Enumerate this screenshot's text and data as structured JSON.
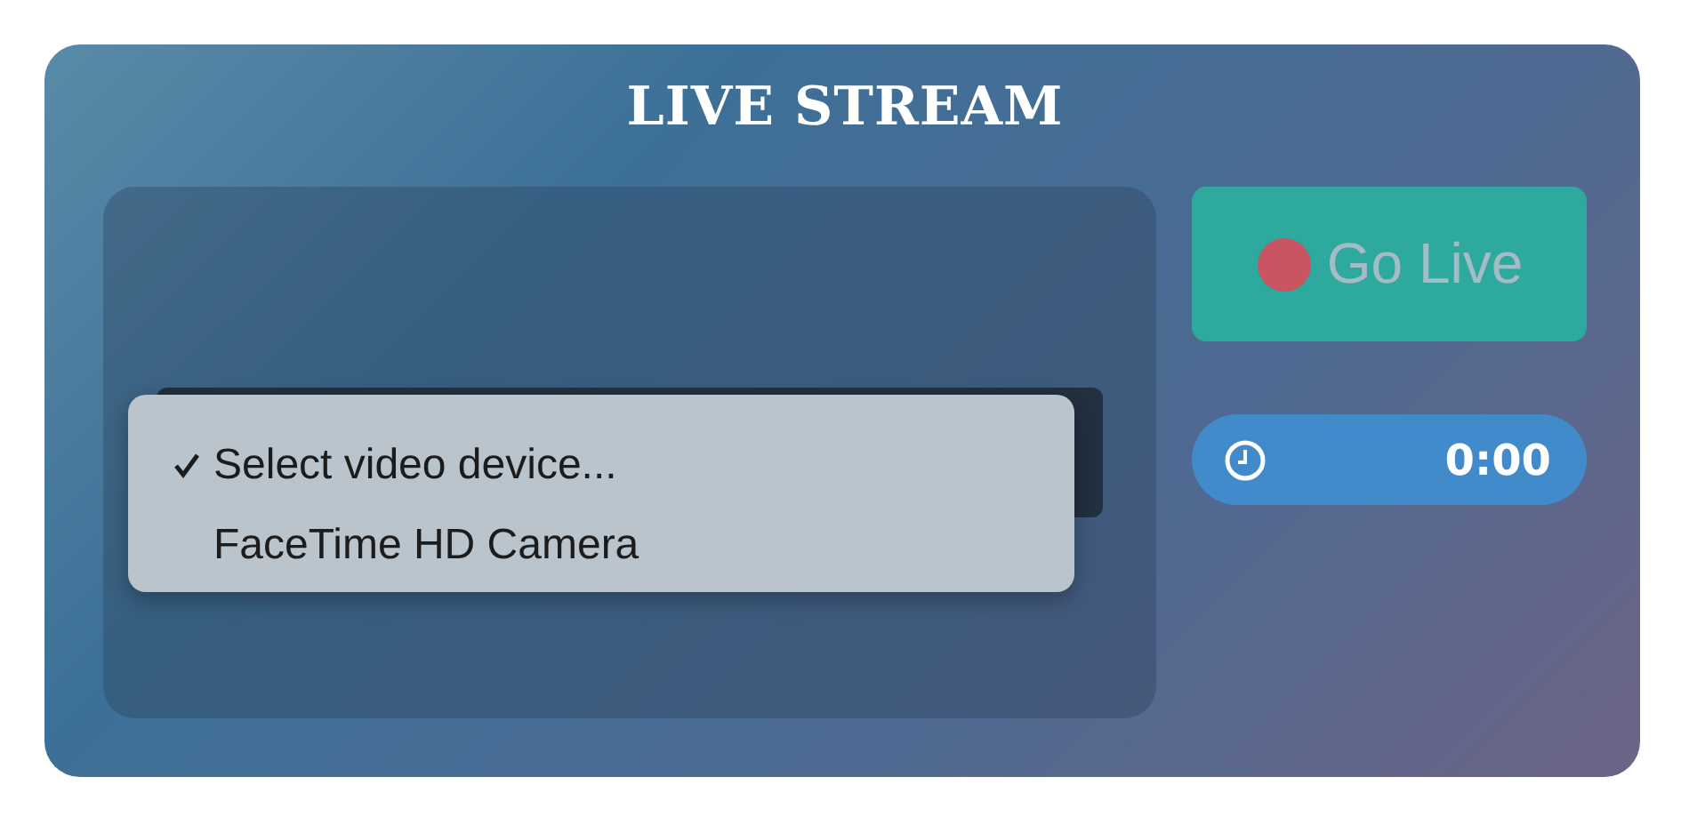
{
  "title": "LIVE STREAM",
  "device_menu": {
    "options": [
      {
        "label": "Select video device...",
        "selected": true
      },
      {
        "label": "FaceTime HD Camera",
        "selected": false
      }
    ]
  },
  "go_live_button": {
    "label": "Go Live",
    "disabled": true
  },
  "timer": {
    "value": "0:00"
  }
}
